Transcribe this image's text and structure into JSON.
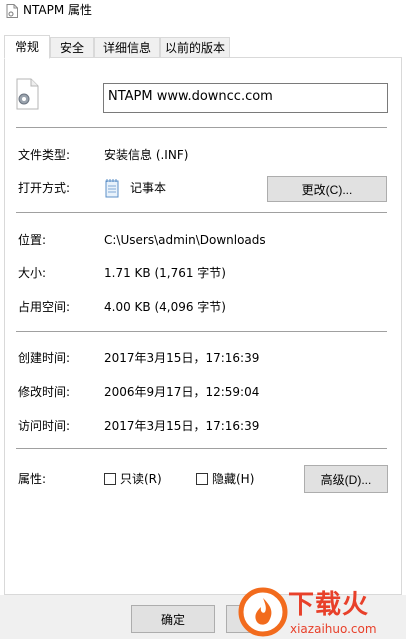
{
  "window": {
    "title": "NTAPM 属性"
  },
  "tabs": [
    {
      "label": "常规"
    },
    {
      "label": "安全"
    },
    {
      "label": "详细信息"
    },
    {
      "label": "以前的版本"
    }
  ],
  "file": {
    "name": "NTAPM    www.downcc.com"
  },
  "info": {
    "type_label": "文件类型:",
    "type_value": "安装信息 (.INF)",
    "open_label": "打开方式:",
    "open_app": "记事本",
    "change_button": "更改(C)...",
    "location_label": "位置:",
    "location_value": "C:\\Users\\admin\\Downloads",
    "size_label": "大小:",
    "size_value": "1.71 KB (1,761 字节)",
    "disk_label": "占用空间:",
    "disk_value": "4.00 KB (4,096 字节)",
    "created_label": "创建时间:",
    "created_value": "2017年3月15日，17:16:39",
    "modified_label": "修改时间:",
    "modified_value": "2006年9月17日，12:59:04",
    "accessed_label": "访问时间:",
    "accessed_value": "2017年3月15日，17:16:39",
    "attr_label": "属性:",
    "readonly_label": "只读(R)",
    "hidden_label": "隐藏(H)",
    "advanced_button": "高级(D)..."
  },
  "footer": {
    "ok_button": "确定"
  },
  "watermark": {
    "brand": "下载火",
    "url": "xiazaihuo.com"
  },
  "colors": {
    "watermark_orange": "#f26b1d",
    "watermark_text": "#e8402a"
  }
}
